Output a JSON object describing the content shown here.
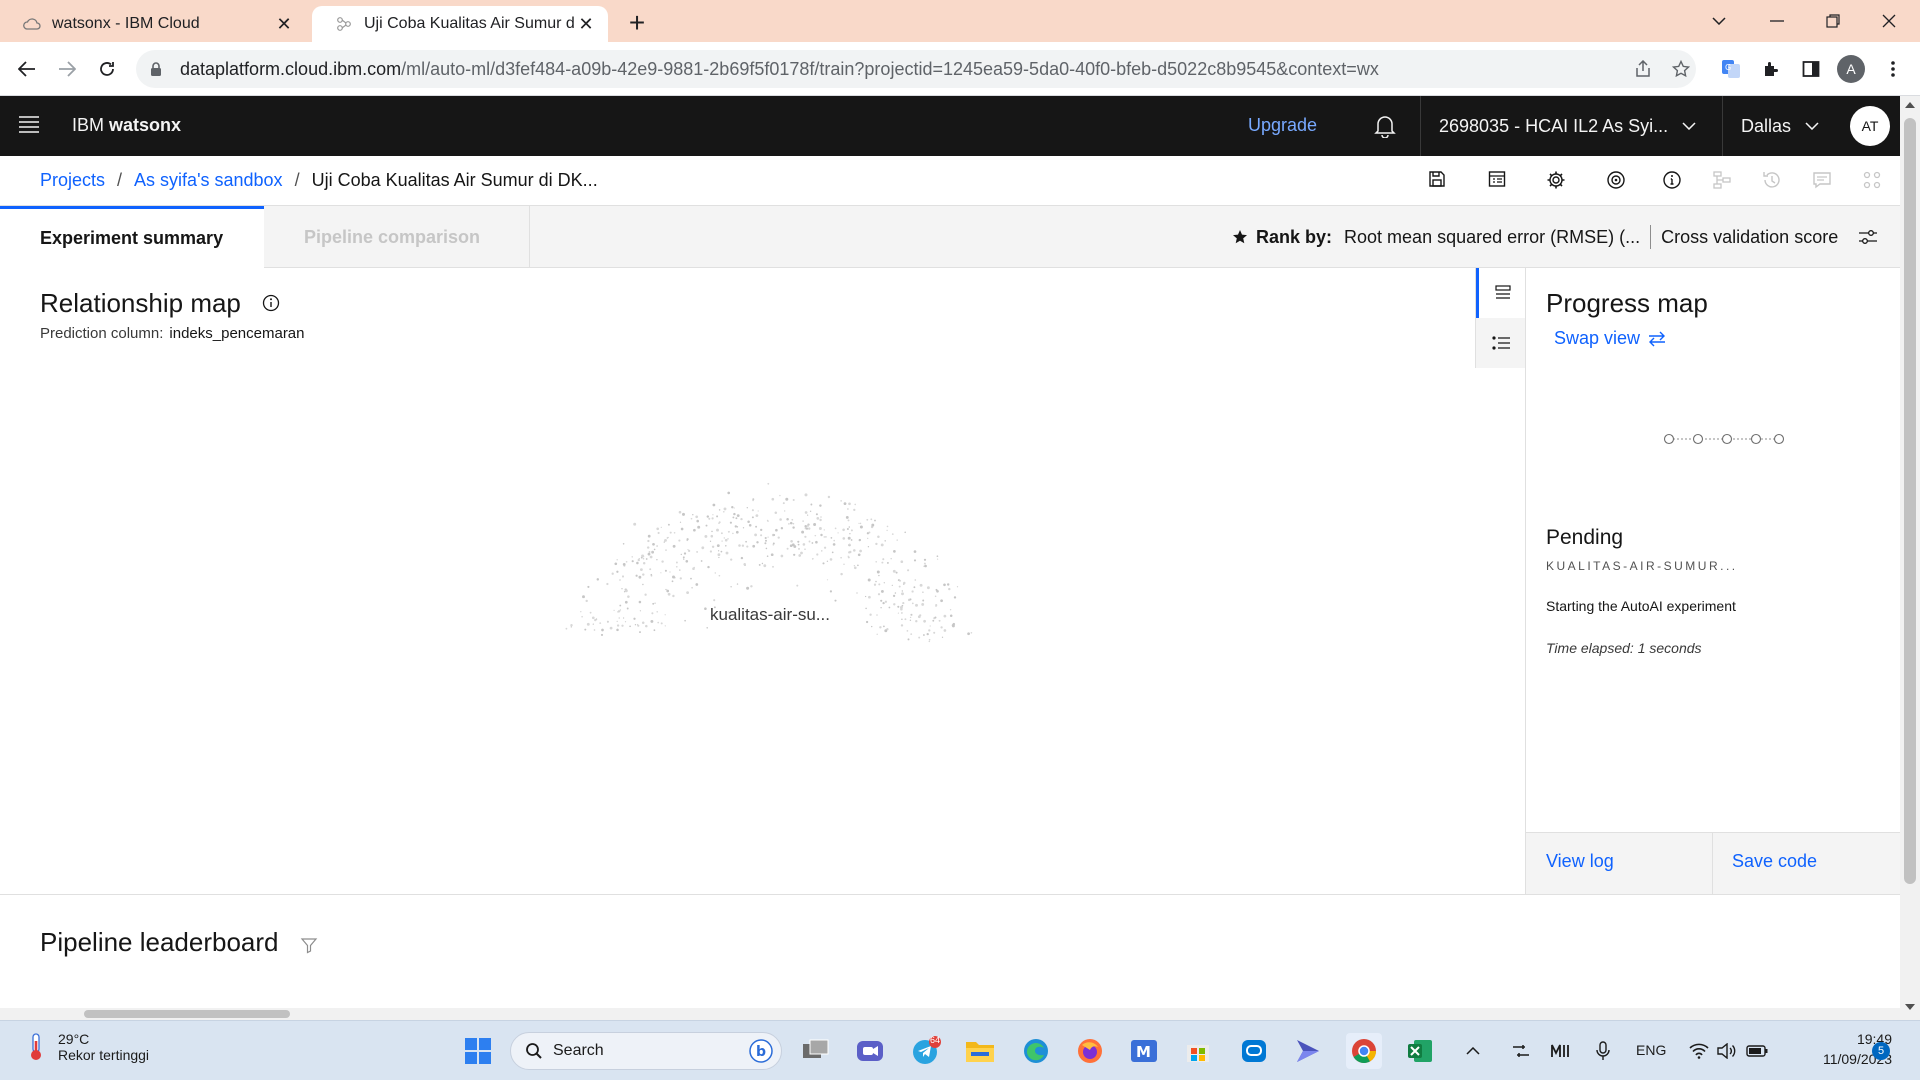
{
  "browser": {
    "tabs": [
      {
        "title": "watsonx - IBM Cloud"
      },
      {
        "title": "Uji Coba Kualitas Air Sumur di DK"
      }
    ],
    "url_host": "dataplatform.cloud.ibm.com",
    "url_path": "/ml/auto-ml/d3fef484-a09b-42e9-9881-2b69f5f0178f/train?projectid=1245ea59-5da0-40f0-bfeb-d5022c8b9545&context=wx",
    "profile_initial": "A"
  },
  "header": {
    "brand_prefix": "IBM",
    "brand_name": "watsonx",
    "upgrade": "Upgrade",
    "account": "2698035 - HCAI IL2 As Syi...",
    "region": "Dallas",
    "avatar": "AT"
  },
  "breadcrumb": {
    "items": [
      "Projects",
      "As syifa's sandbox",
      "Uji Coba Kualitas Air Sumur di DK..."
    ],
    "separator": "/"
  },
  "tabs": {
    "summary": "Experiment summary",
    "comparison": "Pipeline comparison"
  },
  "rank": {
    "label": "Rank by:",
    "metric": "Root mean squared error (RMSE) (...",
    "score": "Cross validation score"
  },
  "relationship_map": {
    "title": "Relationship map",
    "prediction_label": "Prediction column:",
    "prediction_value": "indeks_pencemaran",
    "node_label": "kualitas-air-su..."
  },
  "progress_map": {
    "title": "Progress map",
    "swap_view": "Swap view",
    "status": "Pending",
    "experiment_id": "KUALITAS-AIR-SUMUR...",
    "message": "Starting the AutoAI experiment",
    "elapsed": "Time elapsed: 1 seconds",
    "view_log": "View log",
    "save_code": "Save code"
  },
  "leaderboard": {
    "title": "Pipeline leaderboard"
  },
  "taskbar": {
    "temperature": "29°C",
    "weather_text": "Rekor tertinggi",
    "search": "Search",
    "telegram_badge": "64",
    "language": "ENG",
    "time": "19:49",
    "date": "11/09/2023",
    "notifications": "5"
  },
  "colors": {
    "ibm_blue": "#0f62fe",
    "header_bg": "#161616",
    "tabstrip_bg": "#f9d9c9"
  }
}
